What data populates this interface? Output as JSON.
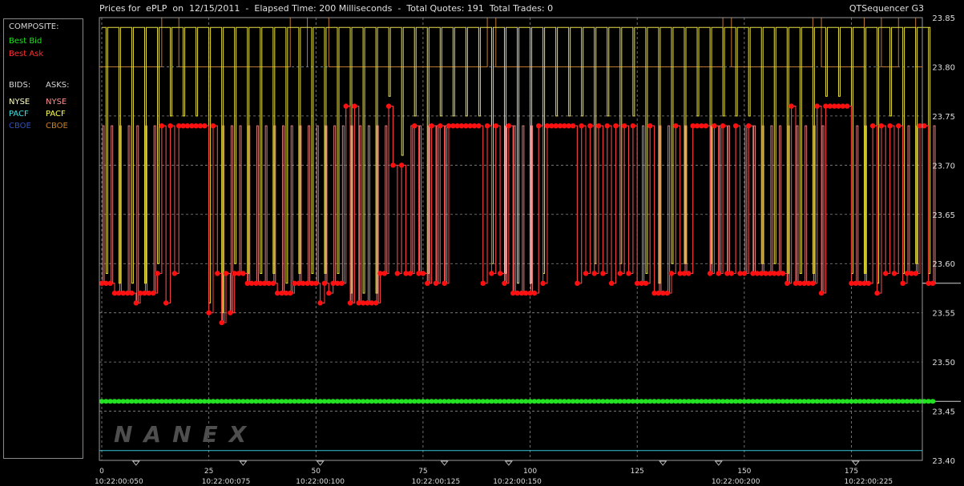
{
  "header": {
    "title": "Prices for  ePLP  on  12/15/2011  -  Elapsed Time: 200 Milliseconds  -  Total Quotes: 191  Total Trades: 0",
    "app_name": "QTSequencer G3"
  },
  "legend": {
    "composite_label": "COMPOSITE:",
    "best_bid": "Best Bid",
    "best_ask": "Best Ask",
    "bids_label": "BIDS:",
    "asks_label": "ASKS:",
    "bids": [
      {
        "name": "NYSE",
        "color": "#ffffc0"
      },
      {
        "name": "PACF",
        "color": "#40e0e0"
      },
      {
        "name": "CBOE",
        "color": "#3050c0"
      }
    ],
    "asks": [
      {
        "name": "NYSE",
        "color": "#ff9090"
      },
      {
        "name": "PACF",
        "color": "#ffff50"
      },
      {
        "name": "CBOE",
        "color": "#d08020"
      }
    ],
    "colors": {
      "best_bid": "#20e020",
      "best_ask": "#ff2020"
    }
  },
  "watermark": "NANEX",
  "chart_data": {
    "type": "line",
    "title": "Prices for  ePLP  on  12/15/2011  -  Elapsed Time: 200 Milliseconds  -  Total Quotes: 191  Total Trades: 0",
    "xlim": [
      0,
      191
    ],
    "ylim": [
      23.4,
      23.85
    ],
    "x_ticks": [
      0,
      25,
      50,
      75,
      100,
      125,
      150,
      175
    ],
    "y_ticks": [
      "23.40",
      "23.45",
      "23.50",
      "23.55",
      "23.60",
      "23.65",
      "23.70",
      "23.75",
      "23.80",
      "23.85"
    ],
    "time_labels": [
      {
        "x": 4,
        "label": "10:22:00:050"
      },
      {
        "x": 29,
        "label": "10:22:00:075"
      },
      {
        "x": 51,
        "label": "10:22:00:100"
      },
      {
        "x": 78,
        "label": "10:22:00:125"
      },
      {
        "x": 97,
        "label": "10:22:00:150"
      },
      {
        "x": 148,
        "label": "10:22:00:200"
      },
      {
        "x": 179,
        "label": "10:22:00:225"
      }
    ],
    "time_markers": [
      8,
      33,
      51,
      80,
      95,
      131,
      144,
      176
    ],
    "grid": true,
    "best_bid_value": 23.46,
    "pacf_bid_value": 23.41,
    "cboe_ask_value": 23.8,
    "pacf_ask_value": 23.84,
    "series": [
      {
        "name": "Best Ask",
        "color": "#ff2020",
        "values": [
          23.58,
          23.58,
          23.58,
          23.57,
          23.57,
          23.57,
          23.57,
          23.57,
          23.56,
          23.57,
          23.57,
          23.57,
          23.57,
          23.59,
          23.74,
          23.56,
          23.74,
          23.59,
          23.74,
          23.74,
          23.74,
          23.74,
          23.74,
          23.74,
          23.74,
          23.55,
          23.74,
          23.59,
          23.54,
          23.59,
          23.55,
          23.59,
          23.59,
          23.59,
          23.58,
          23.58,
          23.58,
          23.58,
          23.58,
          23.58,
          23.58,
          23.57,
          23.57,
          23.57,
          23.57,
          23.58,
          23.58,
          23.58,
          23.58,
          23.58,
          23.58,
          23.56,
          23.58,
          23.57,
          23.58,
          23.58,
          23.58,
          23.76,
          23.56,
          23.76,
          23.56,
          23.56,
          23.56,
          23.56,
          23.56,
          23.59,
          23.59,
          23.76,
          23.7,
          23.59,
          23.7,
          23.59,
          23.59,
          23.74,
          23.59,
          23.59,
          23.58,
          23.74,
          23.58,
          23.74,
          23.58,
          23.74,
          23.74,
          23.74,
          23.74,
          23.74,
          23.74,
          23.74,
          23.74,
          23.58,
          23.74,
          23.59,
          23.74,
          23.59,
          23.58,
          23.74,
          23.57,
          23.57,
          23.57,
          23.57,
          23.57,
          23.57,
          23.74,
          23.58,
          23.74,
          23.74,
          23.74,
          23.74,
          23.74,
          23.74,
          23.74,
          23.58,
          23.74,
          23.59,
          23.74,
          23.59,
          23.74,
          23.59,
          23.74,
          23.58,
          23.74,
          23.59,
          23.74,
          23.59,
          23.74,
          23.58,
          23.58,
          23.58,
          23.74,
          23.57,
          23.57,
          23.57,
          23.57,
          23.59,
          23.74,
          23.59,
          23.59,
          23.59,
          23.74,
          23.74,
          23.74,
          23.74,
          23.59,
          23.74,
          23.59,
          23.74,
          23.59,
          23.59,
          23.74,
          23.59,
          23.59,
          23.74,
          23.59,
          23.59,
          23.59,
          23.59,
          23.59,
          23.59,
          23.59,
          23.59,
          23.58,
          23.76,
          23.58,
          23.58,
          23.58,
          23.58,
          23.58,
          23.76,
          23.57,
          23.76,
          23.76,
          23.76,
          23.76,
          23.76,
          23.76,
          23.58,
          23.58,
          23.58,
          23.58,
          23.58,
          23.74,
          23.57,
          23.74,
          23.59,
          23.74,
          23.59,
          23.74,
          23.58,
          23.59,
          23.59,
          23.59,
          23.74,
          23.74,
          23.58,
          23.58
        ]
      }
    ]
  }
}
